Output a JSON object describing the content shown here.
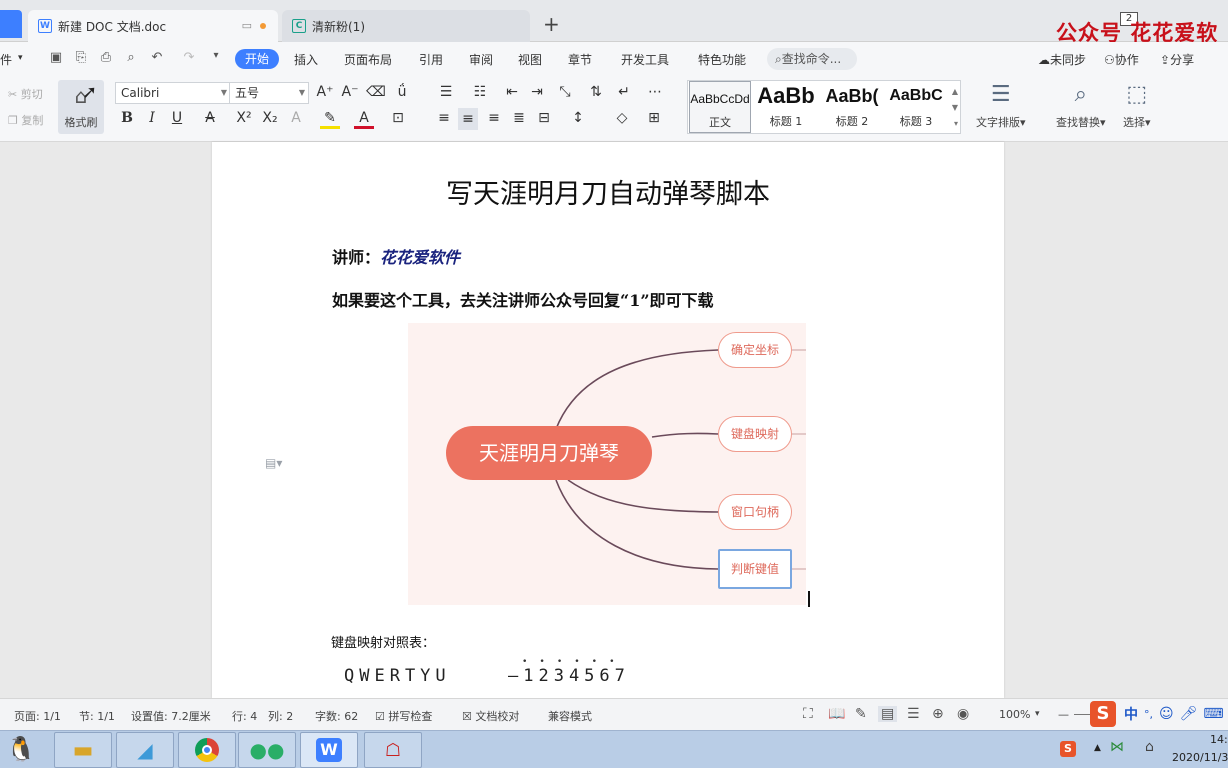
{
  "tabs": {
    "doc_tab": "新建 DOC 文档.doc",
    "second_tab": "清新粉(1)",
    "new_tab": "+"
  },
  "watermark": {
    "text": "公众号  花花爱软",
    "badge": "2"
  },
  "menu": {
    "file_partial": "件",
    "active": "开始",
    "items": [
      "插入",
      "页面布局",
      "引用",
      "审阅",
      "视图",
      "章节",
      "开发工具",
      "特色功能"
    ],
    "search": "查找命令...",
    "sync": "未同步",
    "collab": "协作",
    "share": "分享"
  },
  "ribbon": {
    "cut": "剪切",
    "copy": "复制",
    "format_brush": "格式刷",
    "font_name": "Calibri",
    "font_size": "五号",
    "styles": [
      {
        "preview": "AaBbCcDd",
        "label": "正文"
      },
      {
        "preview": "AaBb",
        "label": "标题 1"
      },
      {
        "preview": "AaBb(",
        "label": "标题 2"
      },
      {
        "preview": "AaBbC",
        "label": "标题 3"
      }
    ],
    "text_layout": "文字排版",
    "find_replace": "查找替换",
    "select": "选择"
  },
  "document": {
    "title": "写天涯明月刀自动弹琴脚本",
    "lecturer_label": "讲师：",
    "lecturer_name": "花花爱软件",
    "note": "如果要这个工具，去关注讲师公众号回复“1”即可下载",
    "mindmap": {
      "center": "天涯明月刀弹琴",
      "nodes": [
        "确定坐标",
        "键盘映射",
        "窗口句柄",
        "判断键值"
      ]
    },
    "keymap_title": "键盘映射对照表：",
    "keys": "QWERTYU",
    "digits": "—1234567",
    "dots": "••••••"
  },
  "status": {
    "page": "页面: 1/1",
    "section": "节: 1/1",
    "setting": "设置值: 7.2厘米",
    "row": "行: 4",
    "col": "列: 2",
    "words": "字数: 62",
    "spell": "拼写检查",
    "proof": "文档校对",
    "compat": "兼容模式",
    "zoom": "100%"
  },
  "ime": {
    "lang": "中",
    "punct": "°,"
  },
  "taskbar": {
    "time": "14:",
    "date": "2020/11/3"
  },
  "colors": {
    "accent": "#3d7fff",
    "mindmap_center": "#ec7260",
    "watermark": "#c8101a"
  }
}
